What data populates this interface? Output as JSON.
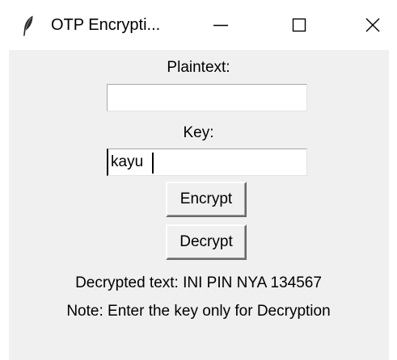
{
  "window": {
    "title": "OTP Encrypti...",
    "app_icon": "feather-icon",
    "controls": {
      "minimize_icon": "minimize-icon",
      "maximize_icon": "maximize-icon",
      "close_icon": "close-icon"
    }
  },
  "form": {
    "plaintext_label": "Plaintext:",
    "plaintext_value": "",
    "key_label": "Key:",
    "key_value": "kayu",
    "encrypt_label": "Encrypt",
    "decrypt_label": "Decrypt"
  },
  "output": {
    "result_text": "Decrypted text: INI PIN NYA 134567",
    "note_text": "Note: Enter the key only for Decryption"
  },
  "colors": {
    "client_background": "#f0f0f0",
    "titlebar_background": "#ffffff",
    "entry_background": "#ffffff"
  }
}
